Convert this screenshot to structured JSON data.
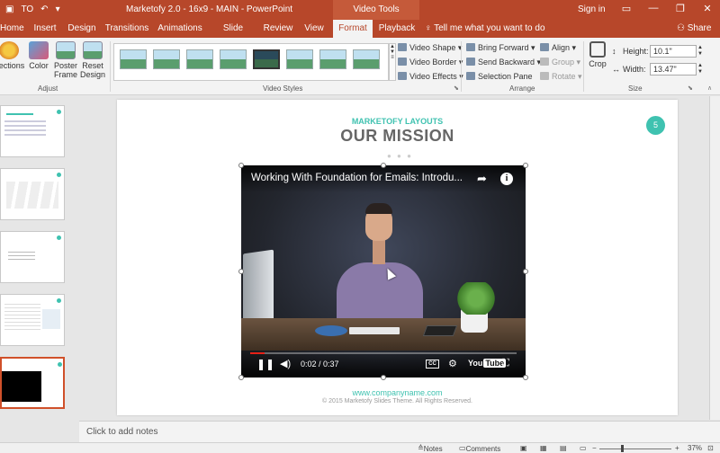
{
  "window": {
    "qat_label": "TO",
    "doc_title": "Marketofy 2.0 - 16x9 - MAIN  -  PowerPoint",
    "context_tab": "Video Tools",
    "signin": "Sign in",
    "restore_icon": "restore-icon",
    "accent": "#b7472a"
  },
  "tabs": [
    {
      "label": "Home"
    },
    {
      "label": "Insert"
    },
    {
      "label": "Design"
    },
    {
      "label": "Transitions"
    },
    {
      "label": "Animations"
    },
    {
      "label": "Slide Show"
    },
    {
      "label": "Review"
    },
    {
      "label": "View"
    },
    {
      "label": "Format"
    },
    {
      "label": "Playback"
    }
  ],
  "tell_me": "Tell me what you want to do",
  "share": "Share",
  "ribbon": {
    "adjust": {
      "label": "Adjust",
      "corrections": "rrections",
      "color": "Color",
      "poster_frame": "Poster Frame",
      "reset_design": "Reset Design"
    },
    "video_styles": {
      "label": "Video Styles",
      "video_shape": "Video Shape",
      "video_border": "Video Border",
      "video_effects": "Video Effects"
    },
    "arrange": {
      "label": "Arrange",
      "bring_forward": "Bring Forward",
      "send_backward": "Send Backward",
      "selection_pane": "Selection Pane",
      "align": "Align",
      "group": "Group",
      "rotate": "Rotate"
    },
    "size": {
      "label": "Size",
      "crop": "Crop",
      "height_label": "Height:",
      "height_value": "10.1\"",
      "width_label": "Width:",
      "width_value": "13.47\""
    }
  },
  "slide": {
    "kicker": "MARKETOFY LAYOUTS",
    "title": "OUR MISSION",
    "number": "5",
    "website": "www.companyname.com",
    "copyright": "© 2015 Marketofy Slides Theme. All Rights Reserved."
  },
  "video": {
    "title": "Working With Foundation for Emails: Introdu...",
    "time": "0:02 / 0:37",
    "progress": 0.054,
    "cc": "CC",
    "brand_a": "You",
    "brand_b": "Tube"
  },
  "notes_placeholder": "Click to add notes",
  "status": {
    "notes": "Notes",
    "comments": "Comments",
    "zoom": "37%"
  }
}
